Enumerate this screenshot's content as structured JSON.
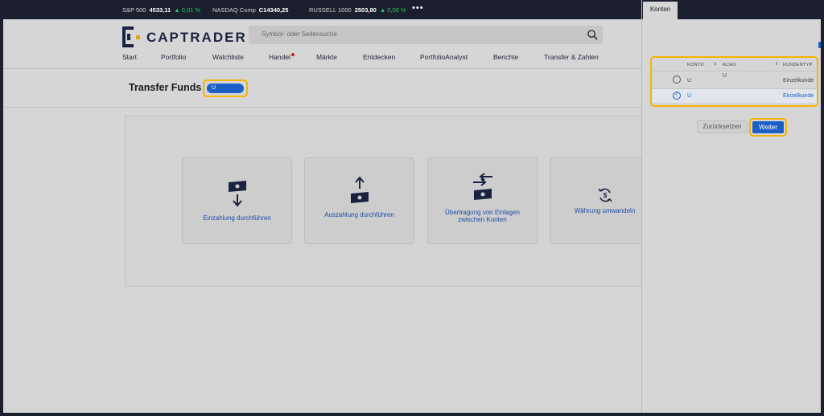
{
  "ticker": {
    "items": [
      {
        "name": "S&P 500",
        "value": "4533,11",
        "change": "▲ 0,01 %"
      },
      {
        "name": "NASDAQ Comp",
        "value": "C14340,25",
        "change": ""
      },
      {
        "name": "RUSSELL 1000",
        "value": "2503,80",
        "change": "▲ 0,00 %"
      }
    ],
    "more": "•••"
  },
  "header": {
    "logo_text": "CAPTRADER",
    "search_placeholder": "Symbol- oder Seitensuche"
  },
  "nav": {
    "items": [
      "Start",
      "Portfolio",
      "Watchliste",
      "Handel",
      "Märkte",
      "Entdecken",
      "PortfolioAnalyst",
      "Berichte",
      "Transfer & Zahlen"
    ]
  },
  "page": {
    "title": "Transfer Funds",
    "account_chip": "U"
  },
  "cards": [
    {
      "label": "Einzahlung durchführen",
      "icon": "deposit-icon"
    },
    {
      "label": "Auszahlung durchführen",
      "icon": "withdraw-icon"
    },
    {
      "label": "Übertragung von Einlagen zwischen Konten",
      "icon": "transfer-icon"
    },
    {
      "label": "Währung umwandeln",
      "icon": "currency-convert-icon"
    }
  ],
  "drawer": {
    "tab": "Konten",
    "columns": [
      "KONTO",
      "ALIAS",
      "KUNDENTYP"
    ],
    "rows": [
      {
        "konto": "U",
        "alias": "U",
        "type": "Einzelkunde",
        "selected": false
      },
      {
        "konto": "U",
        "alias": "",
        "type": "Einzelkunde",
        "selected": true
      }
    ],
    "reset_label": "Zurücksetzen",
    "next_label": "Weiter"
  },
  "colors": {
    "accent": "#1c5fc7",
    "highlight": "#f5b400",
    "navy": "#1b2240",
    "up": "#2fc46b"
  }
}
